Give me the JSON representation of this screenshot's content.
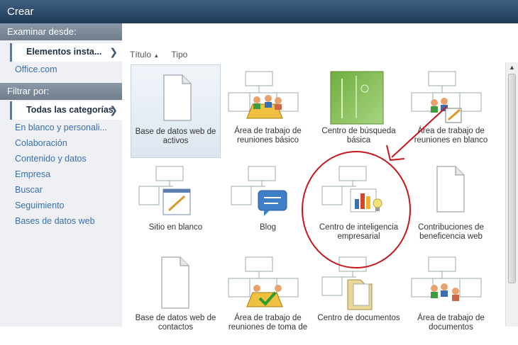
{
  "window": {
    "title": "Crear"
  },
  "sidebar": {
    "browse_heading": "Examinar desde:",
    "browse_items": [
      {
        "label": "Elementos insta...",
        "selected": true
      },
      {
        "label": "Office.com",
        "selected": false
      }
    ],
    "filter_heading": "Filtrar por:",
    "filter_items": [
      {
        "label": "Todas las categorías",
        "selected": true
      },
      {
        "label": "En blanco y personali..."
      },
      {
        "label": "Colaboración"
      },
      {
        "label": "Contenido y datos"
      },
      {
        "label": "Empresa"
      },
      {
        "label": "Buscar"
      },
      {
        "label": "Seguimiento"
      },
      {
        "label": "Bases de datos web"
      }
    ]
  },
  "main": {
    "sort_title": "Título",
    "sort_type": "Tipo",
    "tiles": [
      {
        "label": "Base de datos web de activos",
        "icon": "document-icon",
        "selected": true
      },
      {
        "label": "Área de trabajo de reuniones básico",
        "icon": "meeting-workspace-icon"
      },
      {
        "label": "Centro de búsqueda básica",
        "icon": "search-center-icon"
      },
      {
        "label": "Área de trabajo de reuniones en blanco",
        "icon": "meeting-blank-icon"
      },
      {
        "label": "Sitio en blanco",
        "icon": "blank-site-icon"
      },
      {
        "label": "Blog",
        "icon": "blog-icon"
      },
      {
        "label": "Centro de inteligencia empresarial",
        "icon": "business-intelligence-icon"
      },
      {
        "label": "Contribuciones de beneficencia web",
        "icon": "document-icon"
      },
      {
        "label": "Base de datos web de contactos",
        "icon": "document-icon"
      },
      {
        "label": "Área de trabajo de reuniones de toma de",
        "icon": "decision-meeting-icon"
      },
      {
        "label": "Centro de documentos",
        "icon": "document-center-icon"
      },
      {
        "label": "Área de trabajo de documentos",
        "icon": "document-workspace-icon"
      }
    ]
  },
  "colors": {
    "accent_link": "#3a70ad",
    "annotation_red": "#c4161c",
    "titlebar": "#2b4866"
  }
}
